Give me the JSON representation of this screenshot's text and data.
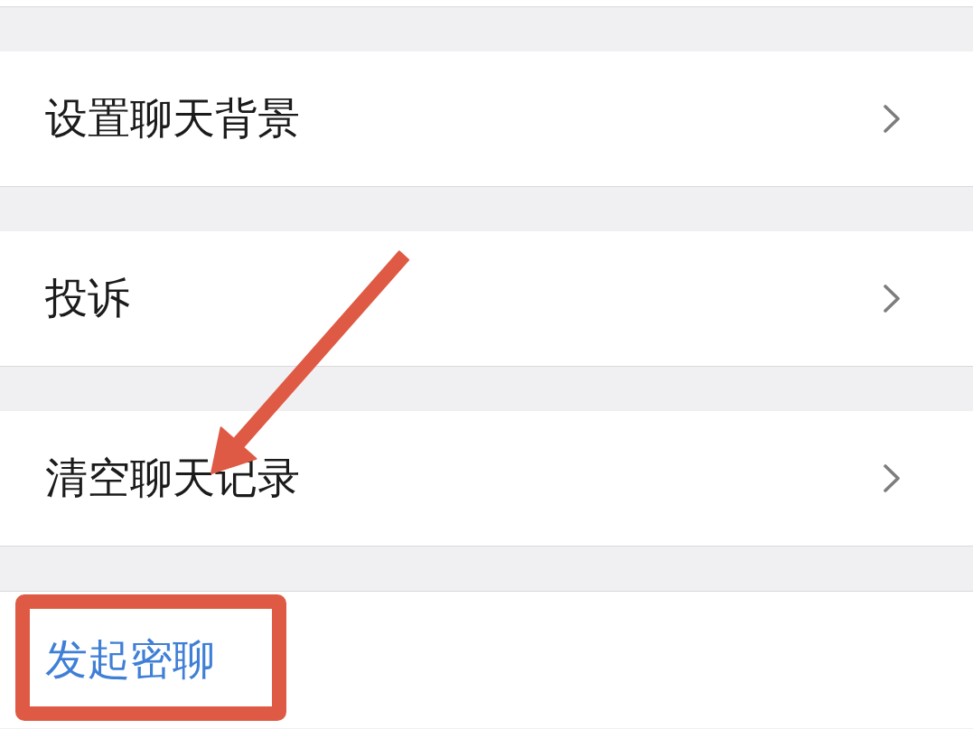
{
  "items": [
    {
      "kind": "navigate",
      "label": "设置聊天背景"
    },
    {
      "kind": "navigate",
      "label": "投诉"
    },
    {
      "kind": "navigate",
      "label": "清空聊天记录",
      "annotation": {
        "kind": "arrow"
      }
    },
    {
      "kind": "action",
      "label": "发起密聊",
      "annotation": {
        "kind": "highlight"
      }
    }
  ]
}
